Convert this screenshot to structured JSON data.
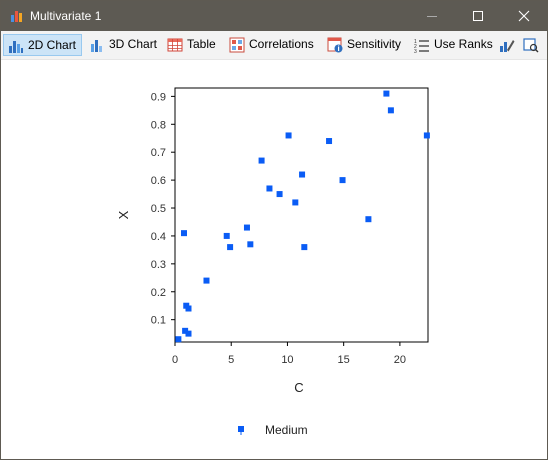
{
  "window": {
    "title": "Multivariate 1",
    "controls": [
      "minimize",
      "maximize",
      "close"
    ]
  },
  "toolbar": {
    "items": [
      {
        "label": "2D Chart",
        "icon": "bar-chart-icon",
        "active": true
      },
      {
        "label": "3D Chart",
        "icon": "3d-chart-icon",
        "active": false
      },
      {
        "label": "Table",
        "icon": "table-icon",
        "active": false
      },
      {
        "label": "Correlations",
        "icon": "correlations-icon",
        "active": false
      },
      {
        "label": "Sensitivity",
        "icon": "sensitivity-icon",
        "active": false
      },
      {
        "label": "Use Ranks",
        "icon": "ranks-icon",
        "active": false
      }
    ],
    "extra_icons": [
      "edit-chart-icon",
      "export-icon"
    ]
  },
  "chart_data": {
    "type": "scatter",
    "title": "",
    "xlabel": "C",
    "ylabel": "X",
    "xlim": [
      0,
      22.5
    ],
    "ylim": [
      0.02,
      0.93
    ],
    "xticks": [
      0,
      5,
      10,
      15,
      20
    ],
    "yticks": [
      0.1,
      0.2,
      0.3,
      0.4,
      0.5,
      0.6,
      0.7,
      0.8,
      0.9
    ],
    "grid": false,
    "legend": "bottom-center",
    "series": [
      {
        "name": "Medium",
        "color": "#0a5cf5",
        "marker": "square",
        "points": [
          [
            0.3,
            0.03
          ],
          [
            0.8,
            0.41
          ],
          [
            0.9,
            0.06
          ],
          [
            1.0,
            0.15
          ],
          [
            1.2,
            0.14
          ],
          [
            1.2,
            0.05
          ],
          [
            2.8,
            0.24
          ],
          [
            4.6,
            0.4
          ],
          [
            4.9,
            0.36
          ],
          [
            6.4,
            0.43
          ],
          [
            6.7,
            0.37
          ],
          [
            7.7,
            0.67
          ],
          [
            8.4,
            0.57
          ],
          [
            9.3,
            0.55
          ],
          [
            10.1,
            0.76
          ],
          [
            10.7,
            0.52
          ],
          [
            11.3,
            0.62
          ],
          [
            11.5,
            0.36
          ],
          [
            13.7,
            0.74
          ],
          [
            14.9,
            0.6
          ],
          [
            17.2,
            0.46
          ],
          [
            18.8,
            0.91
          ],
          [
            19.2,
            0.85
          ],
          [
            22.4,
            0.76
          ]
        ]
      }
    ]
  }
}
